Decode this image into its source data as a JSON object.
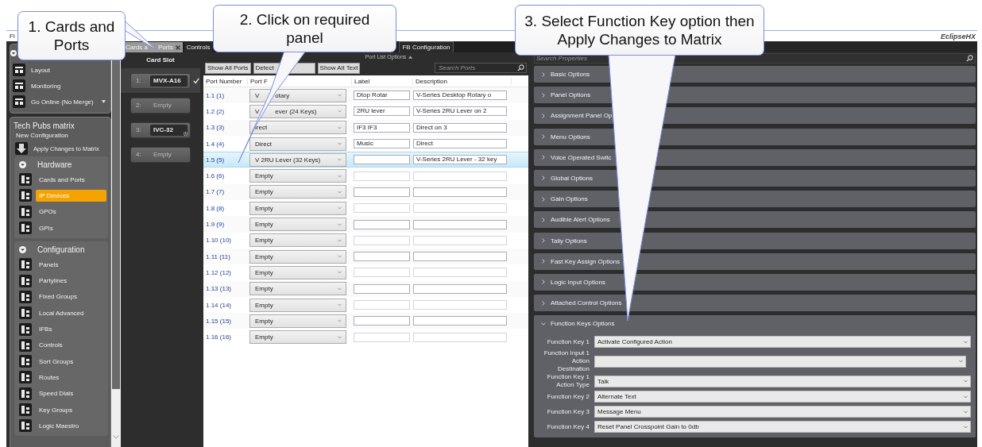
{
  "callouts": [
    {
      "text": "1. Cards and Ports"
    },
    {
      "text": "2. Click on required panel"
    },
    {
      "text": "3. Select Function Key option then Apply Changes to Matrix"
    }
  ],
  "menu": {
    "label": "Fi"
  },
  "logo": "EclipseHX",
  "sidebar": {
    "top_items": [
      {
        "label": "Layout",
        "dropdown": false
      },
      {
        "label": "Monitoring",
        "dropdown": false
      },
      {
        "label": "Go Online (No Merge)",
        "dropdown": true
      }
    ],
    "matrix_title": "Tech Pubs matrix",
    "configuration": "New Configuration",
    "apply": "Apply Changes to Matrix",
    "groups": [
      {
        "title": "Hardware",
        "expanded": true,
        "items": [
          {
            "label": "Cards and Ports",
            "selected": false
          },
          {
            "label": "IP Devices",
            "selected": true
          },
          {
            "label": "GPOs",
            "selected": false
          },
          {
            "label": "GPIs",
            "selected": false
          }
        ]
      },
      {
        "title": "Configuration",
        "expanded": true,
        "items": [
          {
            "label": "Panels",
            "selected": false
          },
          {
            "label": "Partylines",
            "selected": false
          },
          {
            "label": "Fixed Groups",
            "selected": false
          },
          {
            "label": "Local Advanced",
            "selected": false
          },
          {
            "label": "IFBs",
            "selected": false
          },
          {
            "label": "Controls",
            "selected": false
          },
          {
            "label": "Sort Groups",
            "selected": false
          },
          {
            "label": "Routes",
            "selected": false
          },
          {
            "label": "Speed Dials",
            "selected": false
          },
          {
            "label": "Key Groups",
            "selected": false
          },
          {
            "label": "Logic Maestro",
            "selected": false
          }
        ]
      }
    ]
  },
  "tabs": [
    {
      "parts": [
        "Cards a",
        "Ports"
      ],
      "selected": true,
      "closable": true
    },
    {
      "parts": [
        "Controls"
      ],
      "selected": false,
      "closable": false
    },
    {
      "parts": [
        "FB Configuration"
      ],
      "selected": false,
      "closable": false
    }
  ],
  "card_slot": {
    "title": "Card Slot",
    "slots": [
      {
        "number": "1:",
        "name": "MVX-A16",
        "kind": "card",
        "selected": true,
        "settings": false
      },
      {
        "number": "2:",
        "name": "Empty",
        "kind": "empty",
        "selected": false,
        "settings": false
      },
      {
        "number": "3:",
        "name": "IVC-32",
        "kind": "card",
        "selected": false,
        "settings": true
      },
      {
        "number": "4:",
        "name": "Empty",
        "kind": "empty",
        "selected": false,
        "settings": false
      }
    ]
  },
  "port_list": {
    "options_label": "Port List Options",
    "buttons": [
      "Show All Ports",
      "Detect",
      "Show Alt Text"
    ],
    "search": {
      "placeholder": "Search Ports"
    },
    "columns": [
      "Port Number",
      "Port F",
      "Label",
      "Description"
    ],
    "rows": [
      {
        "number": "1.1 (1)",
        "format": [
          "V",
          "otary"
        ],
        "label": "Dtop Rotar",
        "description": "V-Series Desktop Rotary o",
        "selected": false
      },
      {
        "number": "1.2 (2)",
        "format": [
          "V",
          "ever (24 Keys)"
        ],
        "label": "2RU lever",
        "description": "V-Series 2RU Lever on 2",
        "selected": false
      },
      {
        "number": "1.3 (3)",
        "format": [
          "irect"
        ],
        "label": "IF3  IF3",
        "description": "Direct on 3",
        "selected": false
      },
      {
        "number": "1.4 (4)",
        "format": [
          "Direct"
        ],
        "label": "Music",
        "description": "Direct",
        "selected": false
      },
      {
        "number": "1.5 (5)",
        "format": [
          "V 2RU Lever (32 Keys)"
        ],
        "description": "V-Series 2RU Lever - 32 key",
        "selected": true
      },
      {
        "number": "1.6 (6)",
        "format": [
          "Empty"
        ],
        "selected": false
      },
      {
        "number": "1.7 (7)",
        "format": [
          "Empty"
        ],
        "selected": false
      },
      {
        "number": "1.8 (8)",
        "format": [
          "Empty"
        ],
        "selected": false
      },
      {
        "number": "1.9 (9)",
        "format": [
          "Empty"
        ],
        "selected": false
      },
      {
        "number": "1.10 (10)",
        "format": [
          "Empty"
        ],
        "selected": false
      },
      {
        "number": "1.11 (11)",
        "format": [
          "Empty"
        ],
        "selected": false
      },
      {
        "number": "1.12 (12)",
        "format": [
          "Empty"
        ],
        "selected": false
      },
      {
        "number": "1.13 (13)",
        "format": [
          "Empty"
        ],
        "selected": false
      },
      {
        "number": "1.14 (14)",
        "format": [
          "Empty"
        ],
        "selected": false
      },
      {
        "number": "1.15 (15)",
        "format": [
          "Empty"
        ],
        "selected": false
      },
      {
        "number": "1.16 (16)",
        "format": [
          "Empty"
        ],
        "selected": false
      }
    ]
  },
  "properties": {
    "search": {
      "placeholder": "Search Properties"
    },
    "sections": [
      {
        "title": "Basic Options",
        "expanded": false
      },
      {
        "title": "Panel Options",
        "expanded": false
      },
      {
        "title": "Assignment Panel Op",
        "expanded": false
      },
      {
        "title": "Menu Options",
        "expanded": false
      },
      {
        "title": "Voice Operated Switc",
        "expanded": false
      },
      {
        "title": "Global Options",
        "expanded": false
      },
      {
        "title": "Gain Options",
        "expanded": false
      },
      {
        "title": "Audible Alert Options",
        "expanded": false
      },
      {
        "title": "Tally Options",
        "expanded": false
      },
      {
        "title": "Fast Key Assign Options",
        "expanded": false
      },
      {
        "title": "Logic Input Options",
        "expanded": false
      },
      {
        "title": "Attached Control Options",
        "expanded": false
      },
      {
        "title": "Function Keys Options",
        "expanded": true,
        "fields": [
          {
            "label": "Function Key 1",
            "value": "Activate Configured Action"
          },
          {
            "label": "Function Input 1 Action Destination"
          },
          {
            "label": "Function Key 1 Action Type",
            "value": "Talk"
          },
          {
            "label": "Function Key 2",
            "value": "Alternate Text"
          },
          {
            "label": "Function Key 3",
            "value": "Message Menu"
          },
          {
            "label": "Function Key 4",
            "value": "Reset Panel Crosspoint Gain to 0db"
          }
        ]
      }
    ]
  }
}
